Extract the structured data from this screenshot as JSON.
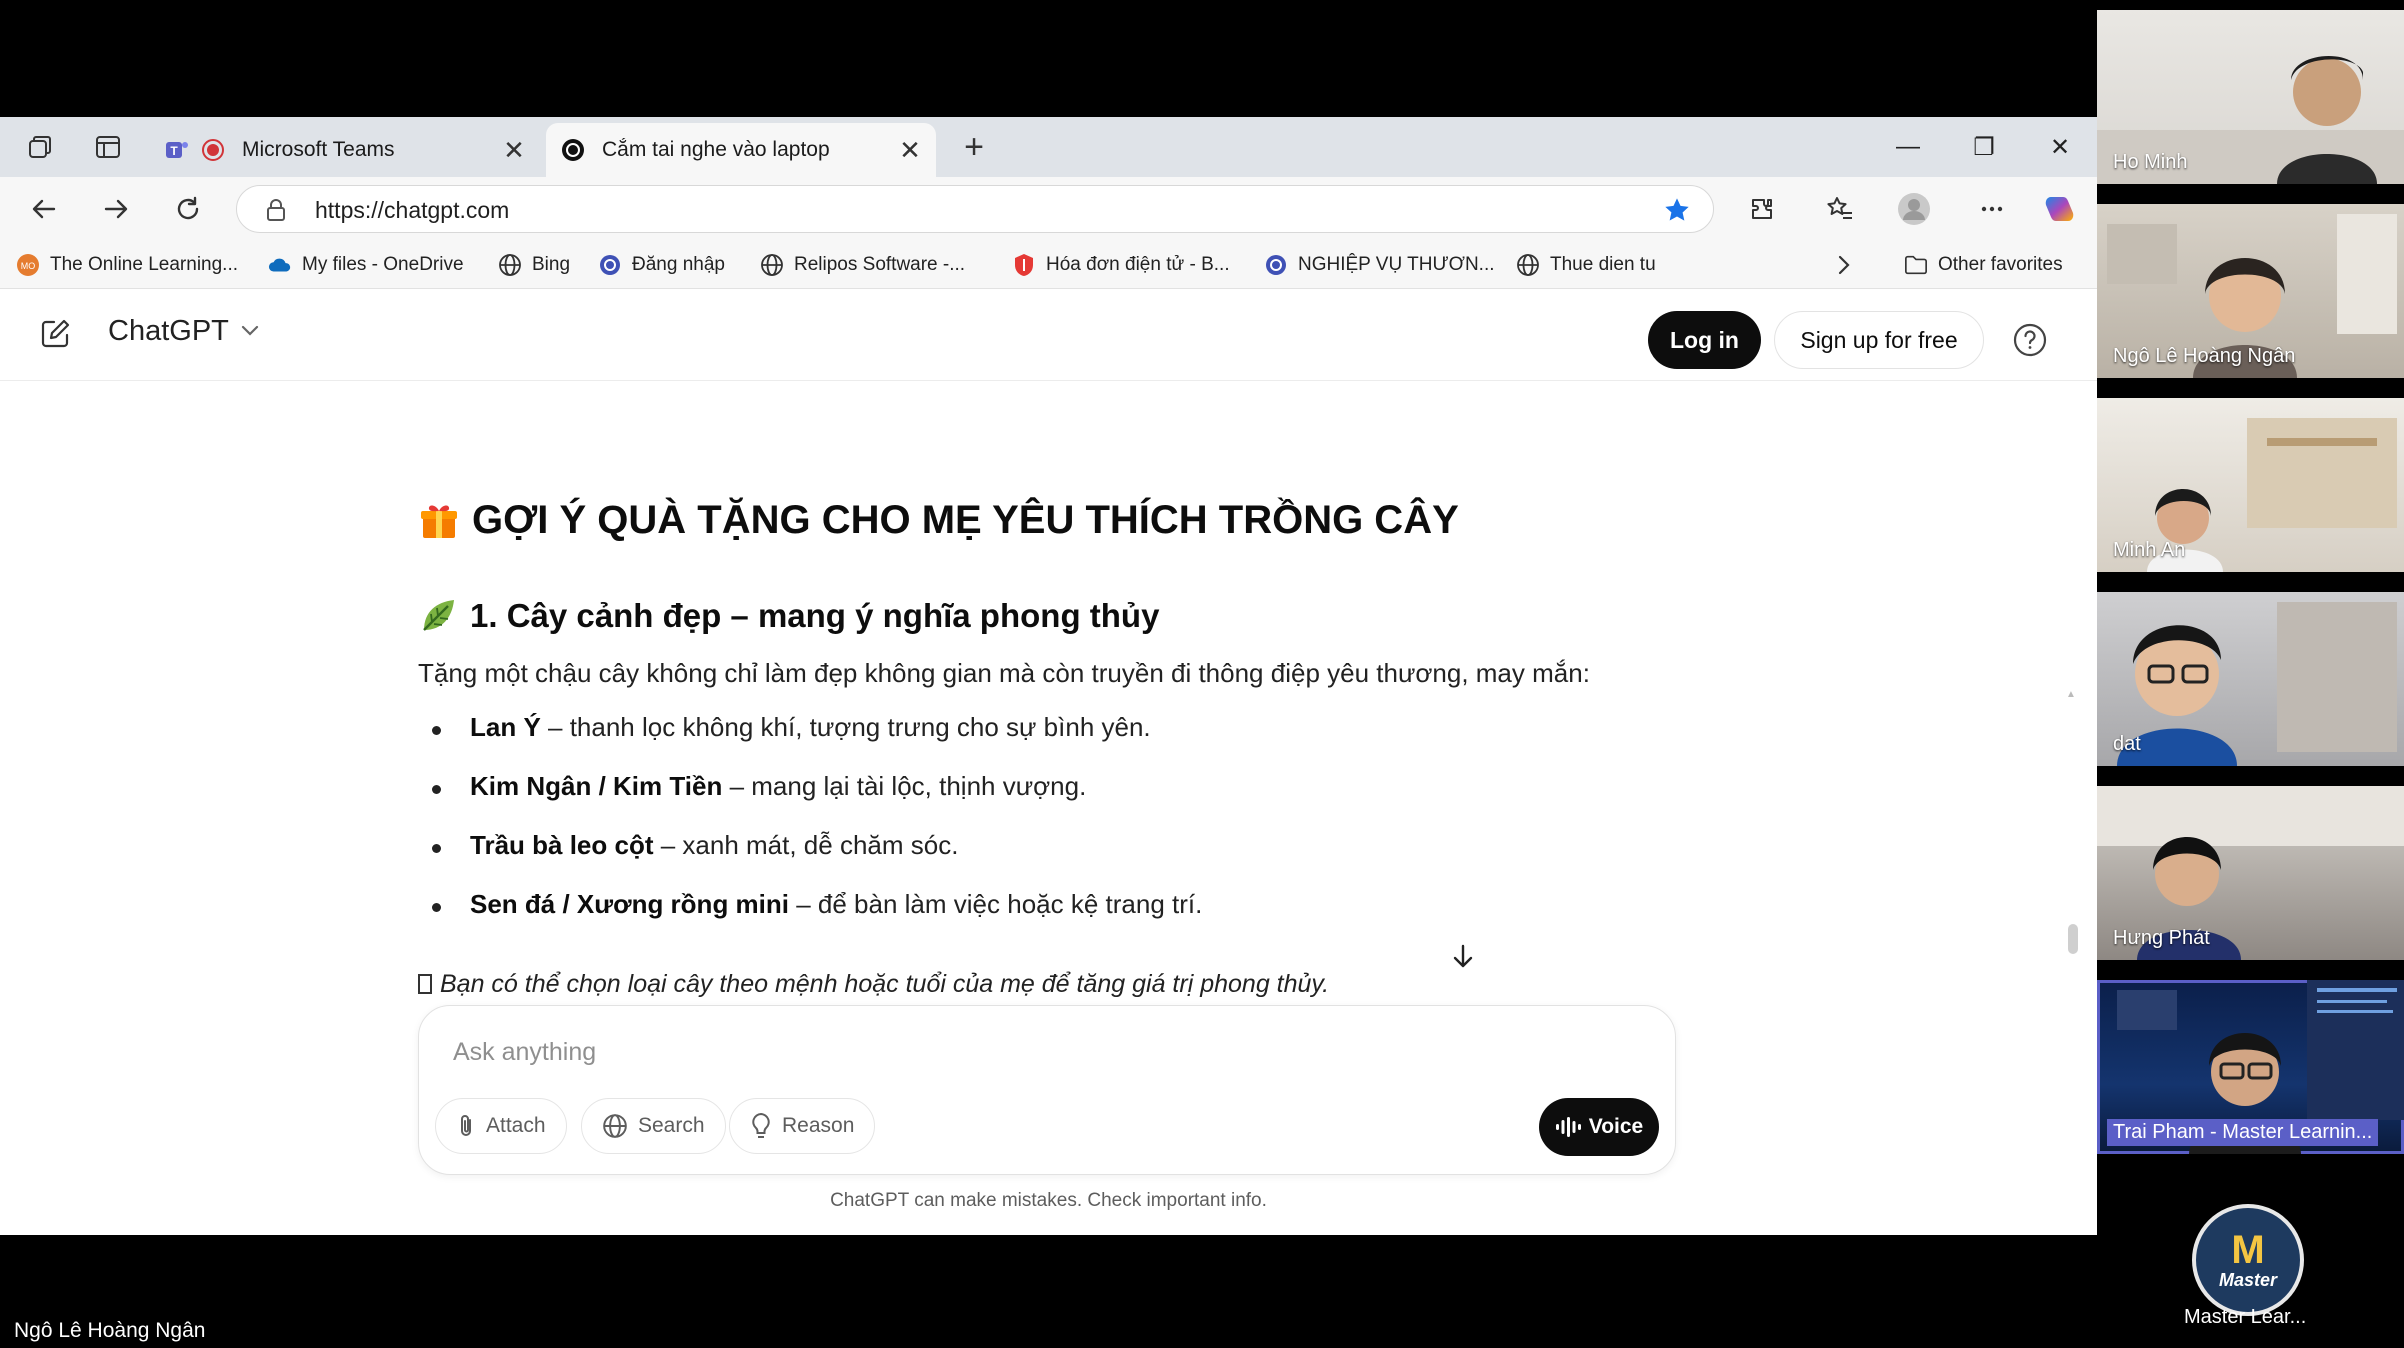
{
  "browser": {
    "tabs": [
      {
        "label": "Microsoft Teams",
        "close": "✕"
      },
      {
        "label": "Cắm tai nghe vào laptop",
        "close": "✕"
      }
    ],
    "new_tab": "+",
    "window_controls": {
      "minimize": "—",
      "restore": "❐",
      "close": "✕"
    },
    "address": {
      "url": "https://chatgpt.com"
    },
    "favorites": [
      {
        "label": "The Online Learning...",
        "icon": "online-learning-icon"
      },
      {
        "label": "My files - OneDrive",
        "icon": "onedrive-icon"
      },
      {
        "label": "Bing",
        "icon": "globe-icon"
      },
      {
        "label": "Đăng nhập",
        "icon": "login-site-icon"
      },
      {
        "label": "Relipos Software -...",
        "icon": "globe-icon"
      },
      {
        "label": "Hóa đơn điện tử - B...",
        "icon": "shield-icon"
      },
      {
        "label": "NGHIỆP VỤ THƯƠN...",
        "icon": "site-icon"
      },
      {
        "label": "Thue dien tu",
        "icon": "globe-icon"
      }
    ],
    "other_favorites": "Other favorites"
  },
  "gpt": {
    "brand": "ChatGPT",
    "login": "Log in",
    "signup": "Sign up for free",
    "help": "?",
    "heading": "GỢI Ý QUÀ TẶNG CHO MẸ YÊU THÍCH TRỒNG CÂY",
    "subheading": "1. Cây cảnh đẹp – mang ý nghĩa phong thủy",
    "intro": "Tặng một chậu cây không chỉ làm đẹp không gian mà còn truyền đi thông điệp yêu thương, may mắn:",
    "items": [
      {
        "bold": "Lan Ý",
        "rest": " – thanh lọc không khí, tượng trưng cho sự bình yên."
      },
      {
        "bold": "Kim Ngân / Kim Tiền",
        "rest": " – mang lại tài lộc, thịnh vượng."
      },
      {
        "bold": "Trầu bà leo cột",
        "rest": " – xanh mát, dễ chăm sóc."
      },
      {
        "bold": "Sen đá / Xương rồng mini",
        "rest": " – để bàn làm việc hoặc kệ trang trí."
      }
    ],
    "tip": "Bạn có thể chọn loại cây theo mệnh hoặc tuổi của mẹ để tăng giá trị phong thủy.",
    "composer": {
      "placeholder": "Ask anything",
      "attach": "Attach",
      "search": "Search",
      "reason": "Reason",
      "voice": "Voice"
    },
    "footnote": "ChatGPT can make mistakes. Check important info."
  },
  "teams": {
    "participants": [
      {
        "name": "Ho Minh"
      },
      {
        "name": "Ngô Lê Hoàng Ngân"
      },
      {
        "name": "Minh An"
      },
      {
        "name": "dat"
      },
      {
        "name": "Hưng Phát"
      },
      {
        "name": "Trai Pham - Master Learnin..."
      }
    ],
    "avatar_logo": {
      "letter": "M",
      "word": "Master"
    },
    "avatar_name": "Master Lear...",
    "self_name": "Ngô Lê Hoàng Ngân"
  }
}
